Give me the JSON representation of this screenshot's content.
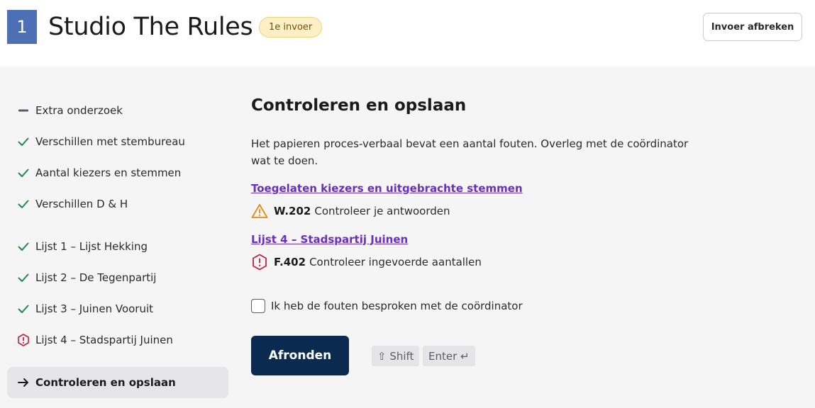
{
  "header": {
    "station_number": "1",
    "title": "Studio The Rules",
    "badge": "1e invoer",
    "abort_label": "Invoer afbreken"
  },
  "nav": {
    "items": [
      {
        "label": "Extra onderzoek",
        "status": "empty"
      },
      {
        "label": "Verschillen met stembureau",
        "status": "done"
      },
      {
        "label": "Aantal kiezers en stemmen",
        "status": "done"
      },
      {
        "label": "Verschillen D & H",
        "status": "done"
      },
      {
        "label": "Lijst 1 – Lijst Hekking",
        "status": "done"
      },
      {
        "label": "Lijst 2 – De Tegenpartij",
        "status": "done"
      },
      {
        "label": "Lijst 3 – Juinen Vooruit",
        "status": "done"
      },
      {
        "label": "Lijst 4 – Stadspartij Juinen",
        "status": "error"
      },
      {
        "label": "Controleren en opslaan",
        "status": "active"
      }
    ]
  },
  "main": {
    "title": "Controleren en opslaan",
    "intro": "Het papieren proces-verbaal bevat een aantal fouten. Overleg met de coördinator wat te doen.",
    "sections": [
      {
        "link": "Toegelaten kiezers en uitgebrachte stemmen",
        "code": "W.202",
        "message": "Controleer je antwoorden",
        "level": "warning"
      },
      {
        "link": "Lijst 4 – Stadspartij Juinen",
        "code": "F.402",
        "message": "Controleer ingevoerde aantallen",
        "level": "error"
      }
    ],
    "checkbox_label": "Ik heb de fouten besproken met de coördinator",
    "finish_label": "Afronden",
    "shortcut_shift": "⇧ Shift",
    "shortcut_enter": "Enter ↵"
  },
  "colors": {
    "station_badge": "#4c6fb5",
    "success": "#1f8a4c",
    "warning": "#e6890c",
    "error": "#c8213a",
    "link": "#6b2fc0",
    "primary_button": "#0b2a4f"
  }
}
